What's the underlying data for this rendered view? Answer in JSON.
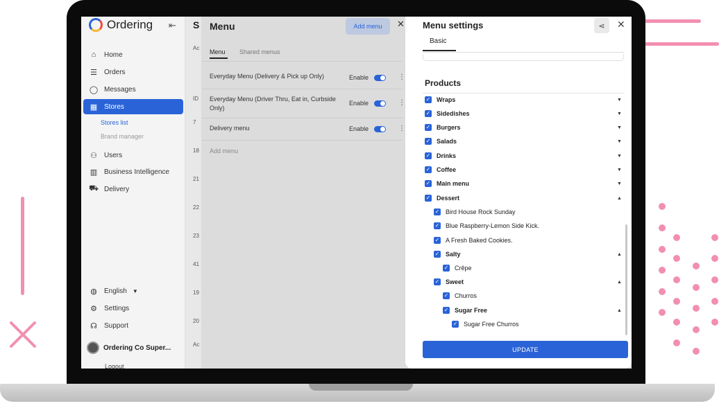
{
  "sidebar": {
    "brand": "Ordering",
    "nav": [
      {
        "label": "Home",
        "icon": "home-icon",
        "glyph": "⌂"
      },
      {
        "label": "Orders",
        "icon": "list-icon",
        "glyph": "☰"
      },
      {
        "label": "Messages",
        "icon": "chat-icon",
        "glyph": "◯"
      },
      {
        "label": "Stores",
        "icon": "store-icon",
        "glyph": "▦"
      },
      {
        "label": "Users",
        "icon": "users-icon",
        "glyph": "⚇"
      },
      {
        "label": "Business Intelligence",
        "icon": "bar-chart-icon",
        "glyph": "▥"
      },
      {
        "label": "Delivery",
        "icon": "truck-icon",
        "glyph": "⛟"
      }
    ],
    "stores_sub": {
      "stores_list": "Stores list",
      "brand_manager": "Brand manager"
    },
    "footer": {
      "language": "English",
      "settings": "Settings",
      "support": "Support",
      "profile_name": "Ordering Co Super...",
      "logout": "Logout"
    }
  },
  "stores_column": {
    "title": "S",
    "tab_stub": "Ac",
    "id_header": "ID",
    "ids": [
      "7",
      "18",
      "21",
      "22",
      "23",
      "41",
      "19",
      "20"
    ],
    "add_stub": "Ac"
  },
  "menu_panel": {
    "title": "Menu",
    "add_button": "Add menu",
    "tabs": [
      "Menu",
      "Shared menus"
    ],
    "rows": [
      {
        "name": "Everyday Menu (Delivery & Pick up Only)",
        "status": "Enable"
      },
      {
        "name": "Everyday Menu (Driver Thru, Eat in, Curbside Only)",
        "status": "Enable"
      },
      {
        "name": "Delivery menu",
        "status": "Enable"
      }
    ],
    "add_menu_link": "Add menu"
  },
  "settings": {
    "title": "Menu settings",
    "tab": "Basic",
    "products_title": "Products",
    "categories": [
      {
        "label": "Wraps"
      },
      {
        "label": "Sidedishes"
      },
      {
        "label": "Burgers"
      },
      {
        "label": "Salads"
      },
      {
        "label": "Drinks"
      },
      {
        "label": "Coffee"
      },
      {
        "label": "Main menu"
      },
      {
        "label": "Dessert"
      }
    ],
    "dessert_children": {
      "items": [
        "Bird House Rock Sunday",
        "Blue Raspberry-Lemon Side Kick.",
        "A Fresh Baked Cookies."
      ],
      "salty": {
        "label": "Salty",
        "items": [
          "Crêpe"
        ]
      },
      "sweet": {
        "label": "Sweet",
        "items": [
          "Churros"
        ],
        "sugar_free": {
          "label": "Sugar Free",
          "items": [
            "Sugar Free Churros"
          ]
        }
      }
    },
    "update_button": "UPDATE"
  },
  "colors": {
    "accent": "#2a63d8",
    "decor_pink": "#f28fb0",
    "overlay_gray": "#dcdcdc"
  }
}
